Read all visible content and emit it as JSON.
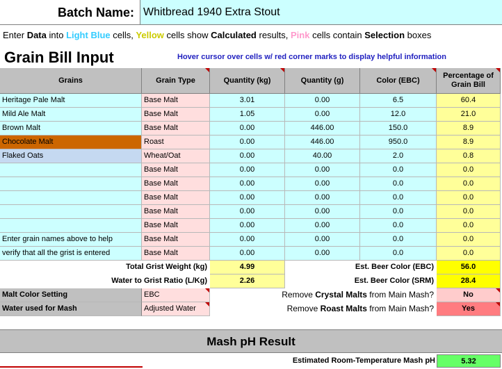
{
  "batch": {
    "label": "Batch Name:",
    "value": "Whitbread 1940 Extra Stout"
  },
  "instructions": {
    "part1": "Enter ",
    "data": "Data",
    "part2": " into ",
    "light_blue": "Light Blue",
    "part3": " cells, ",
    "yellow": "Yellow",
    "part4": " cells show ",
    "calculated": "Calculated",
    "part5": " results, ",
    "pink": "Pink",
    "part6": " cells contain ",
    "selection": "Selection",
    "part7": " boxes"
  },
  "section_title": "Grain Bill Input",
  "hover_note": "Hover cursor over cells w/ red corner marks to display helpful information",
  "columns": [
    "Grains",
    "Grain Type",
    "Quantity (kg)",
    "Quantity (g)",
    "Color (EBC)",
    "Percentage of Grain Bill"
  ],
  "rows": [
    {
      "grain": "Heritage Pale Malt",
      "type": "Base Malt",
      "kg": "3.01",
      "g": "0.00",
      "ebc": "6.5",
      "pct": "60.4"
    },
    {
      "grain": "Mild Ale Malt",
      "type": "Base Malt",
      "kg": "1.05",
      "g": "0.00",
      "ebc": "12.0",
      "pct": "21.0"
    },
    {
      "grain": "Brown Malt",
      "type": "Base Malt",
      "kg": "0.00",
      "g": "446.00",
      "ebc": "150.0",
      "pct": "8.9"
    },
    {
      "grain": "Chocolate Malt",
      "type": "Roast",
      "kg": "0.00",
      "g": "446.00",
      "ebc": "950.0",
      "pct": "8.9"
    },
    {
      "grain": "Flaked Oats",
      "type": "Wheat/Oat",
      "kg": "0.00",
      "g": "40.00",
      "ebc": "2.0",
      "pct": "0.8"
    },
    {
      "grain": "",
      "type": "Base Malt",
      "kg": "0.00",
      "g": "0.00",
      "ebc": "0.0",
      "pct": "0.0"
    },
    {
      "grain": "",
      "type": "Base Malt",
      "kg": "0.00",
      "g": "0.00",
      "ebc": "0.0",
      "pct": "0.0"
    },
    {
      "grain": "",
      "type": "Base Malt",
      "kg": "0.00",
      "g": "0.00",
      "ebc": "0.0",
      "pct": "0.0"
    },
    {
      "grain": "",
      "type": "Base Malt",
      "kg": "0.00",
      "g": "0.00",
      "ebc": "0.0",
      "pct": "0.0"
    },
    {
      "grain": "",
      "type": "Base Malt",
      "kg": "0.00",
      "g": "0.00",
      "ebc": "0.0",
      "pct": "0.0"
    },
    {
      "grain": "Enter grain names above to help",
      "type": "Base Malt",
      "kg": "0.00",
      "g": "0.00",
      "ebc": "0.0",
      "pct": "0.0"
    },
    {
      "grain": "verify that all the grist is entered",
      "type": "Base Malt",
      "kg": "0.00",
      "g": "0.00",
      "ebc": "0.0",
      "pct": "0.0"
    }
  ],
  "row_colors": [
    "#ccffff",
    "#ccffff",
    "#ccffff",
    "#cc6600",
    "#c5d9f1",
    "#ccffff",
    "#ccffff",
    "#ccffff",
    "#ccffff",
    "#ccffff",
    "#ccffff",
    "#ccffff"
  ],
  "totals": {
    "grist_label": "Total Grist Weight (kg)",
    "grist_value": "4.99",
    "ratio_label": "Water to Grist Ratio (L/Kg)",
    "ratio_value": "2.26",
    "ebc_label": "Est. Beer Color (EBC)",
    "ebc_value": "56.0",
    "srm_label": "Est. Beer Color (SRM)",
    "srm_value": "28.4"
  },
  "settings": {
    "malt_color_label": "Malt Color Setting",
    "malt_color_value": "EBC",
    "water_label": "Water used for Mash",
    "water_value": "Adjusted Water",
    "crystal_pre": "Remove ",
    "crystal_bold": "Crystal Malts",
    "crystal_post": " from Main Mash?",
    "crystal_value": "No",
    "roast_pre": "Remove ",
    "roast_bold": "Roast Malts",
    "roast_post": " from Main Mash?",
    "roast_value": "Yes"
  },
  "mash": {
    "title": "Mash pH Result",
    "ph_label": "Estimated Room-Temperature Mash pH",
    "ph_value": "5.32"
  },
  "colors": {
    "light_blue": "#ccffff",
    "pink_cell": "#ffdede",
    "yellow_cell": "#ffff99",
    "red_no": "#ffcccc",
    "red_yes": "#ff7c80",
    "green_ph": "#66ff66"
  }
}
